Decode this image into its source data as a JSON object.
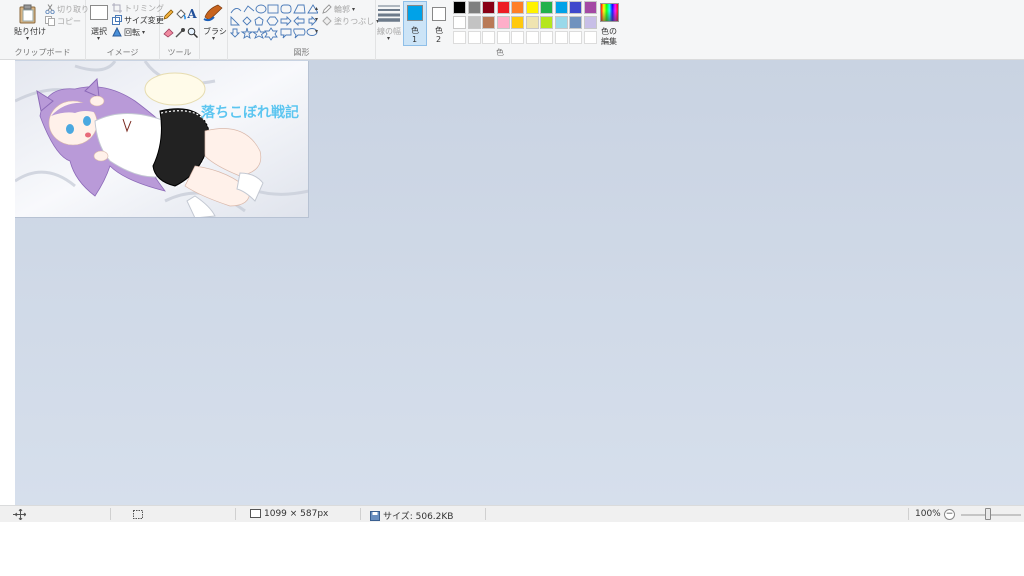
{
  "ribbon": {
    "clipboard": {
      "paste_label": "貼り付け",
      "cut_label": "切り取り",
      "copy_label": "コピー",
      "group_label": "クリップボード"
    },
    "image": {
      "select_label": "選択",
      "crop_label": "トリミング",
      "resize_label": "サイズ変更",
      "rotate_label": "回転",
      "group_label": "イメージ"
    },
    "tools": {
      "group_label": "ツール"
    },
    "brushes": {
      "label": "ブラシ"
    },
    "shapes": {
      "outline_label": "輪郭",
      "fill_label": "塗りつぶし",
      "group_label": "図形"
    },
    "colors": {
      "line_width_label": "線の幅",
      "color1_label_a": "色",
      "color1_label_b": "1",
      "color2_label_a": "色",
      "color2_label_b": "2",
      "edit_colors_label_a": "色の",
      "edit_colors_label_b": "編集",
      "group_label": "色",
      "color1_value": "#00a2e8",
      "color2_value": "#ffffff",
      "palette_row1": [
        "#000000",
        "#7f7f7f",
        "#880015",
        "#ed1c24",
        "#ff7f27",
        "#fff200",
        "#22b14c",
        "#00a2e8",
        "#3f48cc",
        "#a349a4"
      ],
      "palette_row2": [
        "#ffffff",
        "#c3c3c3",
        "#b97a57",
        "#ffaec9",
        "#ffc90e",
        "#efe4b0",
        "#b5e61d",
        "#99d9ea",
        "#7092be",
        "#c8bfe7"
      ],
      "palette_row3": [
        "#ffffff",
        "#ffffff",
        "#ffffff",
        "#ffffff",
        "#ffffff",
        "#ffffff",
        "#ffffff",
        "#ffffff",
        "#ffffff",
        "#ffffff"
      ]
    }
  },
  "canvas": {
    "title_text": "落ちこぼれ戦記",
    "title_color": "#5cc5f0"
  },
  "status": {
    "dimensions": "1099 × 587px",
    "size": "サイズ: 506.2KB",
    "zoom": "100%",
    "zoom_out_symbol": "−"
  }
}
